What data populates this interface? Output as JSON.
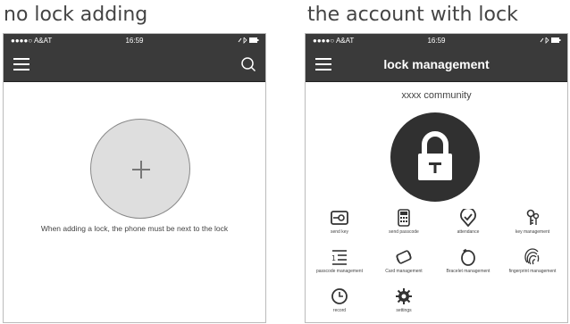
{
  "captions": {
    "left": "no lock adding",
    "right": "the account with lock"
  },
  "status_bar": {
    "carrier": "●●●●○ A&AT",
    "time": "16:59"
  },
  "left_screen": {
    "hint": "When adding a lock, the phone must be next to the lock"
  },
  "right_screen": {
    "title": "lock management",
    "community": "xxxx community",
    "grid": [
      {
        "label": "send key",
        "icon": "key-icon"
      },
      {
        "label": "send passcode",
        "icon": "calculator-icon"
      },
      {
        "label": "attendance",
        "icon": "check-pin-icon"
      },
      {
        "label": "key management",
        "icon": "keys-icon"
      },
      {
        "label": "passcode management",
        "icon": "list-icon"
      },
      {
        "label": "Card management",
        "icon": "card-icon"
      },
      {
        "label": "Bracelet management",
        "icon": "bracelet-icon"
      },
      {
        "label": "fingerprint management",
        "icon": "fingerprint-icon"
      },
      {
        "label": "record",
        "icon": "clock-icon"
      },
      {
        "label": "settings",
        "icon": "gear-icon"
      }
    ]
  },
  "colors": {
    "bar": "#3a3a3a",
    "circle_fill": "#dedede",
    "lock_circle": "#303030"
  }
}
